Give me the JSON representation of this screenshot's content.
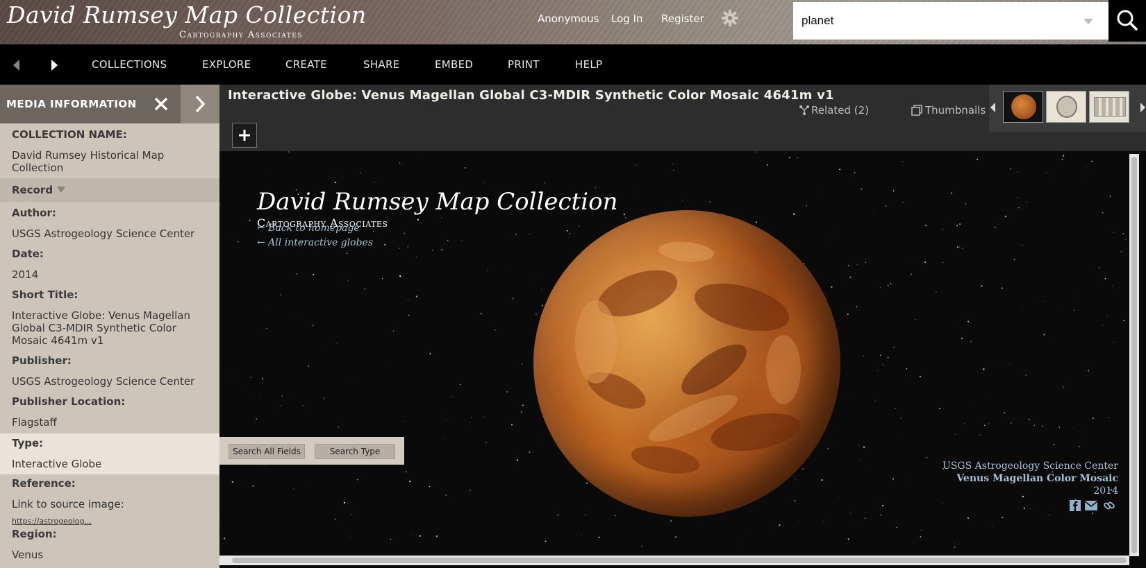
{
  "header": {
    "logo_title": "David Rumsey Map Collection",
    "logo_subtitle": "Cartography Associates",
    "anonymous": "Anonymous",
    "login": "Log In",
    "register": "Register",
    "search_value": "planet",
    "icons": {
      "settings": "gear-icon",
      "search": "search-icon",
      "dropdown": "chevron-down-icon"
    }
  },
  "nav": {
    "back_icon": "chevron-left-icon",
    "forward_icon": "chevron-right-icon",
    "items": [
      "COLLECTIONS",
      "EXPLORE",
      "CREATE",
      "SHARE",
      "EMBED",
      "PRINT",
      "HELP"
    ]
  },
  "media_panel": {
    "header": "MEDIA INFORMATION",
    "fields": {
      "collection_label": "COLLECTION NAME:",
      "collection_value": "David Rumsey Historical Map Collection",
      "record_label": "Record",
      "author_label": "Author:",
      "author_value": "USGS Astrogeology Science Center",
      "date_label": "Date:",
      "date_value": "2014",
      "short_title_label": "Short Title:",
      "short_title_value": "Interactive Globe: Venus Magellan Global C3-MDIR Synthetic Color Mosaic 4641m v1",
      "publisher_label": "Publisher:",
      "publisher_value": "USGS Astrogeology Science Center",
      "publisher_location_label": "Publisher Location:",
      "publisher_location_value": "Flagstaff",
      "type_label": "Type:",
      "type_value": "Interactive Globe",
      "reference_label": "Reference:",
      "reference_value": "Link to source image:",
      "reference_link": "https://astrogeolog...",
      "region_label": "Region:",
      "region_value": "Venus"
    },
    "popup": {
      "search_all": "Search All Fields",
      "search_type": "Search Type"
    }
  },
  "content": {
    "title": "Interactive Globe: Venus Magellan Global C3-MDIR Synthetic Color Mosaic 4641m v1",
    "related": "Related (2)",
    "thumbnails": "Thumbnails",
    "plus_label": "+"
  },
  "viewer": {
    "title": "David Rumsey Map Collection",
    "subtitle": "Cartography Associates",
    "back_link": "← Back to homepage",
    "globes_link": "← All interactive globes",
    "credit_org": "USGS Astrogeology Science Center",
    "credit_title": "Venus Magellan Color Mosaic",
    "credit_year": "2014",
    "share_icons": [
      "facebook-icon",
      "mail-icon",
      "link-icon"
    ]
  },
  "colors": {
    "panel_bg": "#cdc5b9",
    "panel_header": "#6e665e",
    "titlebar": "#2d2d2d",
    "credit_text": "#a8c3d8",
    "planet": "#c7692a"
  }
}
